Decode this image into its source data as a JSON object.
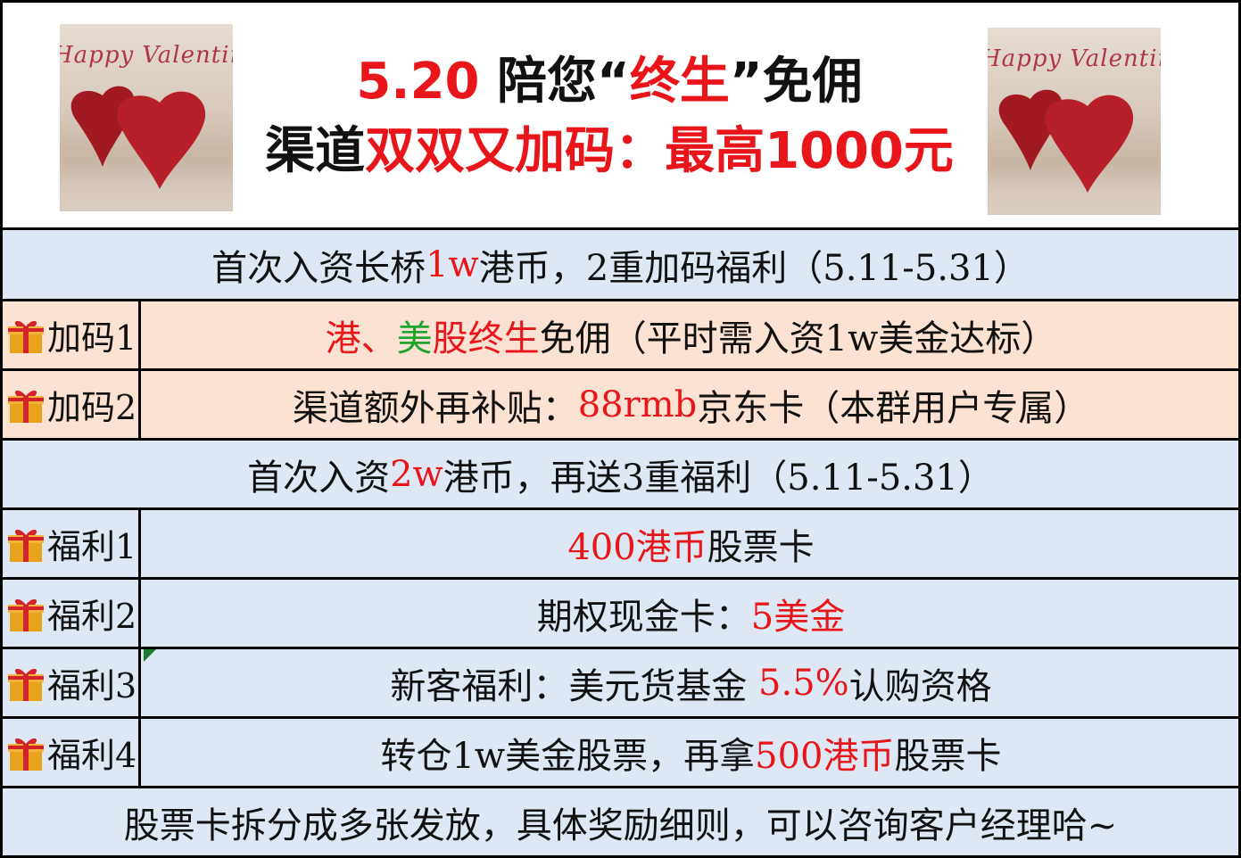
{
  "banner": {
    "image_text": "Happy Valentine",
    "line1": {
      "num": "5.20",
      "a": "陪您“",
      "b": "终生",
      "c": "”免佣"
    },
    "line2": {
      "a": "渠道",
      "b": "双双又加码：最高1000元"
    }
  },
  "section1": {
    "a": "首次入资长桥",
    "b": "1w",
    "c": "港币，2重加码福利（5.11-5.31）"
  },
  "bonus1": {
    "label": "加码1",
    "p1": "港",
    "p2": "、",
    "p3": "美",
    "p4": "股终生",
    "p5": "免佣（平时需入资1w美金达标）"
  },
  "bonus2": {
    "label": "加码2",
    "p1": "渠道额外再补贴：",
    "p2": "88rmb",
    "p3": "京东卡（本群用户专属）"
  },
  "section2": {
    "a": "首次入资",
    "b": "2w",
    "c": "港币，再送3重福利（5.11-5.31）"
  },
  "welfare1": {
    "label": "福利1",
    "p1": "400港币",
    "p2": "股票卡"
  },
  "welfare2": {
    "label": "福利2",
    "p1": "期权现金卡：",
    "p2": "5美金"
  },
  "welfare3": {
    "label": "福利3",
    "p1": "新客福利：美元货基金 ",
    "p2": "5.5%",
    "p3": "认购资格"
  },
  "welfare4": {
    "label": "福利4",
    "p1": "转仓1w美金股票，再拿",
    "p2": "500港币",
    "p3": "股票卡"
  },
  "footer": {
    "text": "股票卡拆分成多张发放，具体奖励细则，可以咨询客户经理哈~"
  },
  "colors": {
    "highlight": "#e8161a",
    "green": "#1fa52c",
    "row_blue": "#dde8f4",
    "row_peach": "#fbe2d3"
  },
  "icons": [
    "gift-icon",
    "heart-icon"
  ]
}
